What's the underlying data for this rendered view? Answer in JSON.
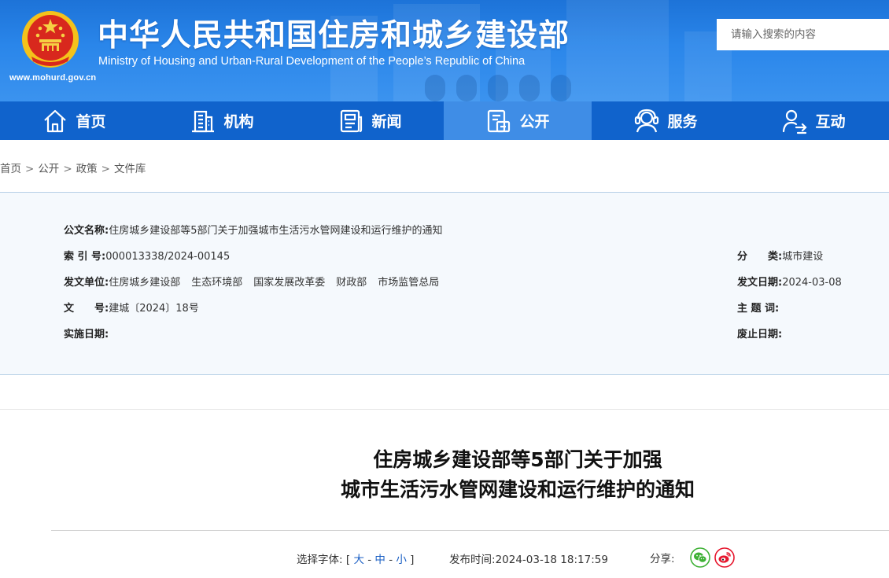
{
  "header": {
    "site_url": "www.mohurd.gov.cn",
    "title": "中华人民共和国住房和城乡建设部",
    "subtitle": "Ministry of Housing and Urban-Rural Development of the People’s Republic of China",
    "search_placeholder": "请输入搜索的内容"
  },
  "nav": {
    "items": [
      {
        "label": "首页",
        "icon": "home-icon",
        "active": false
      },
      {
        "label": "机构",
        "icon": "building-icon",
        "active": false
      },
      {
        "label": "新闻",
        "icon": "news-icon",
        "active": false
      },
      {
        "label": "公开",
        "icon": "disclosure-icon",
        "active": true
      },
      {
        "label": "服务",
        "icon": "service-icon",
        "active": false
      },
      {
        "label": "互动",
        "icon": "interaction-icon",
        "active": false
      }
    ]
  },
  "breadcrumb": [
    "首页",
    "公开",
    "政策",
    "文件库"
  ],
  "meta": {
    "doc_name_label": "公文名称:",
    "doc_name": "住房城乡建设部等5部门关于加强城市生活污水管网建设和运行维护的通知",
    "index_label": "索 引 号:",
    "index": "000013338/2024-00145",
    "category_label": "分　　类:",
    "category": "城市建设",
    "issuer_label": "发文单位:",
    "issuers": [
      "住房城乡建设部",
      "生态环境部",
      "国家发展改革委",
      "财政部",
      "市场监管总局"
    ],
    "issue_date_label": "发文日期:",
    "issue_date": "2024-03-08",
    "doc_no_label": "文　　号:",
    "doc_no": "建城〔2024〕18号",
    "subject_label": "主 题 词:",
    "subject": "",
    "effective_label": "实施日期:",
    "effective": "",
    "expiry_label": "废止日期:",
    "expiry": ""
  },
  "article": {
    "title_line1": "住房城乡建设部等5部门关于加强",
    "title_line2": "城市生活污水管网建设和运行维护的通知"
  },
  "tools": {
    "font_label": "选择字体:",
    "bracket_open": "[",
    "font_large": "大",
    "font_medium": "中",
    "font_small": "小",
    "dash": "-",
    "bracket_close": "]",
    "publish_label": "发布时间:",
    "publish_time": "2024-03-18 18:17:59",
    "share_label": "分享:"
  },
  "colors": {
    "banner_blue": "#1d73d8",
    "nav_blue": "#1063cc",
    "nav_active": "#3f8de6",
    "meta_bg": "#f5f9fd",
    "link_blue": "#1a5fc4",
    "wechat_green": "#3eb135",
    "weibo_red": "#e6162d"
  }
}
